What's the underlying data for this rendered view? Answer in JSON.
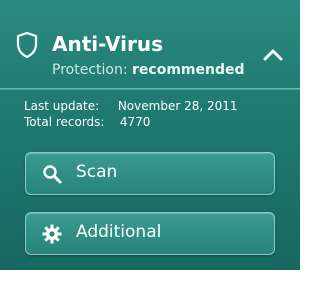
{
  "header": {
    "title": "Anti-Virus",
    "protection_label": "Protection:",
    "protection_value": "recommended"
  },
  "info": {
    "last_update_label": "Last update:",
    "last_update_value": "November 28, 2011",
    "total_records_label": "Total records:",
    "total_records_value": "4770"
  },
  "buttons": {
    "scan": {
      "label": "Scan",
      "icon": "search-icon"
    },
    "additional": {
      "label": "Additional",
      "icon": "gear-icon"
    }
  },
  "colors": {
    "panel": "#1f7a70",
    "button": "#2e8d82",
    "text": "#ffffff"
  }
}
